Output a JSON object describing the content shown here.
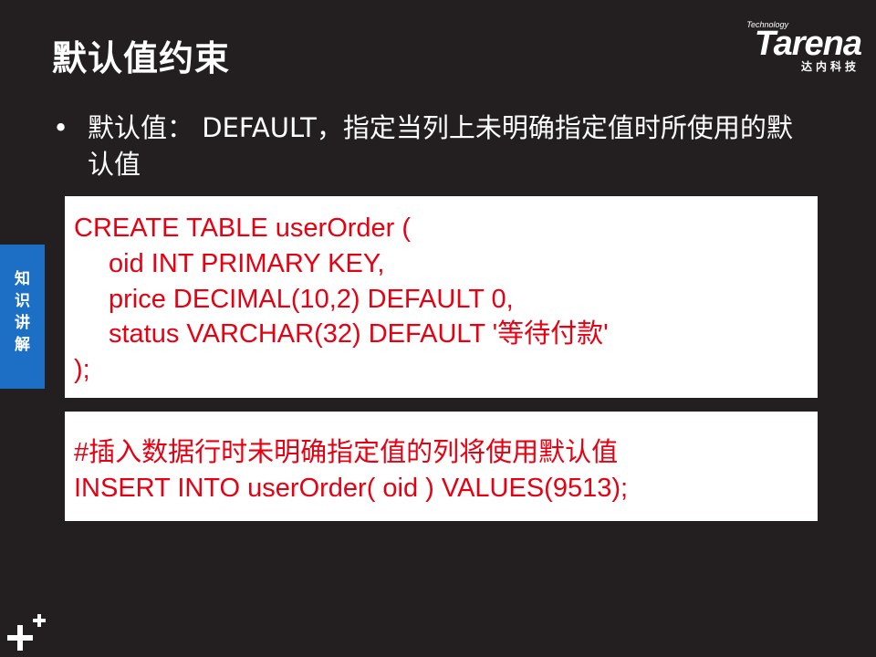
{
  "slide": {
    "title": "默认值约束",
    "bullet": {
      "dot": "•",
      "text": "默认值： DEFAULT，指定当列上未明确指定值时所使用的默认值"
    }
  },
  "logo": {
    "technology": "Technology",
    "brand": "Tarena",
    "tagline": "达内科技"
  },
  "side_tab": {
    "label_chars": [
      "知",
      "识",
      "讲",
      "解"
    ]
  },
  "code_block_1": {
    "lines": [
      "CREATE TABLE userOrder (",
      "oid INT PRIMARY KEY,",
      "price DECIMAL(10,2) DEFAULT 0,",
      "status VARCHAR(32) DEFAULT '等待付款'",
      ");"
    ]
  },
  "code_block_2": {
    "lines": [
      "#插入数据行时未明确指定值的列将使用默认值",
      "INSERT INTO userOrder( oid ) VALUES(9513);"
    ]
  },
  "colors": {
    "background": "#231f20",
    "code_text": "#e60012",
    "code_background": "#ffffff",
    "side_tab": "#1c6fc4",
    "text": "#ffffff"
  },
  "icons": {
    "bottom_left": "plus-plus-icon"
  }
}
